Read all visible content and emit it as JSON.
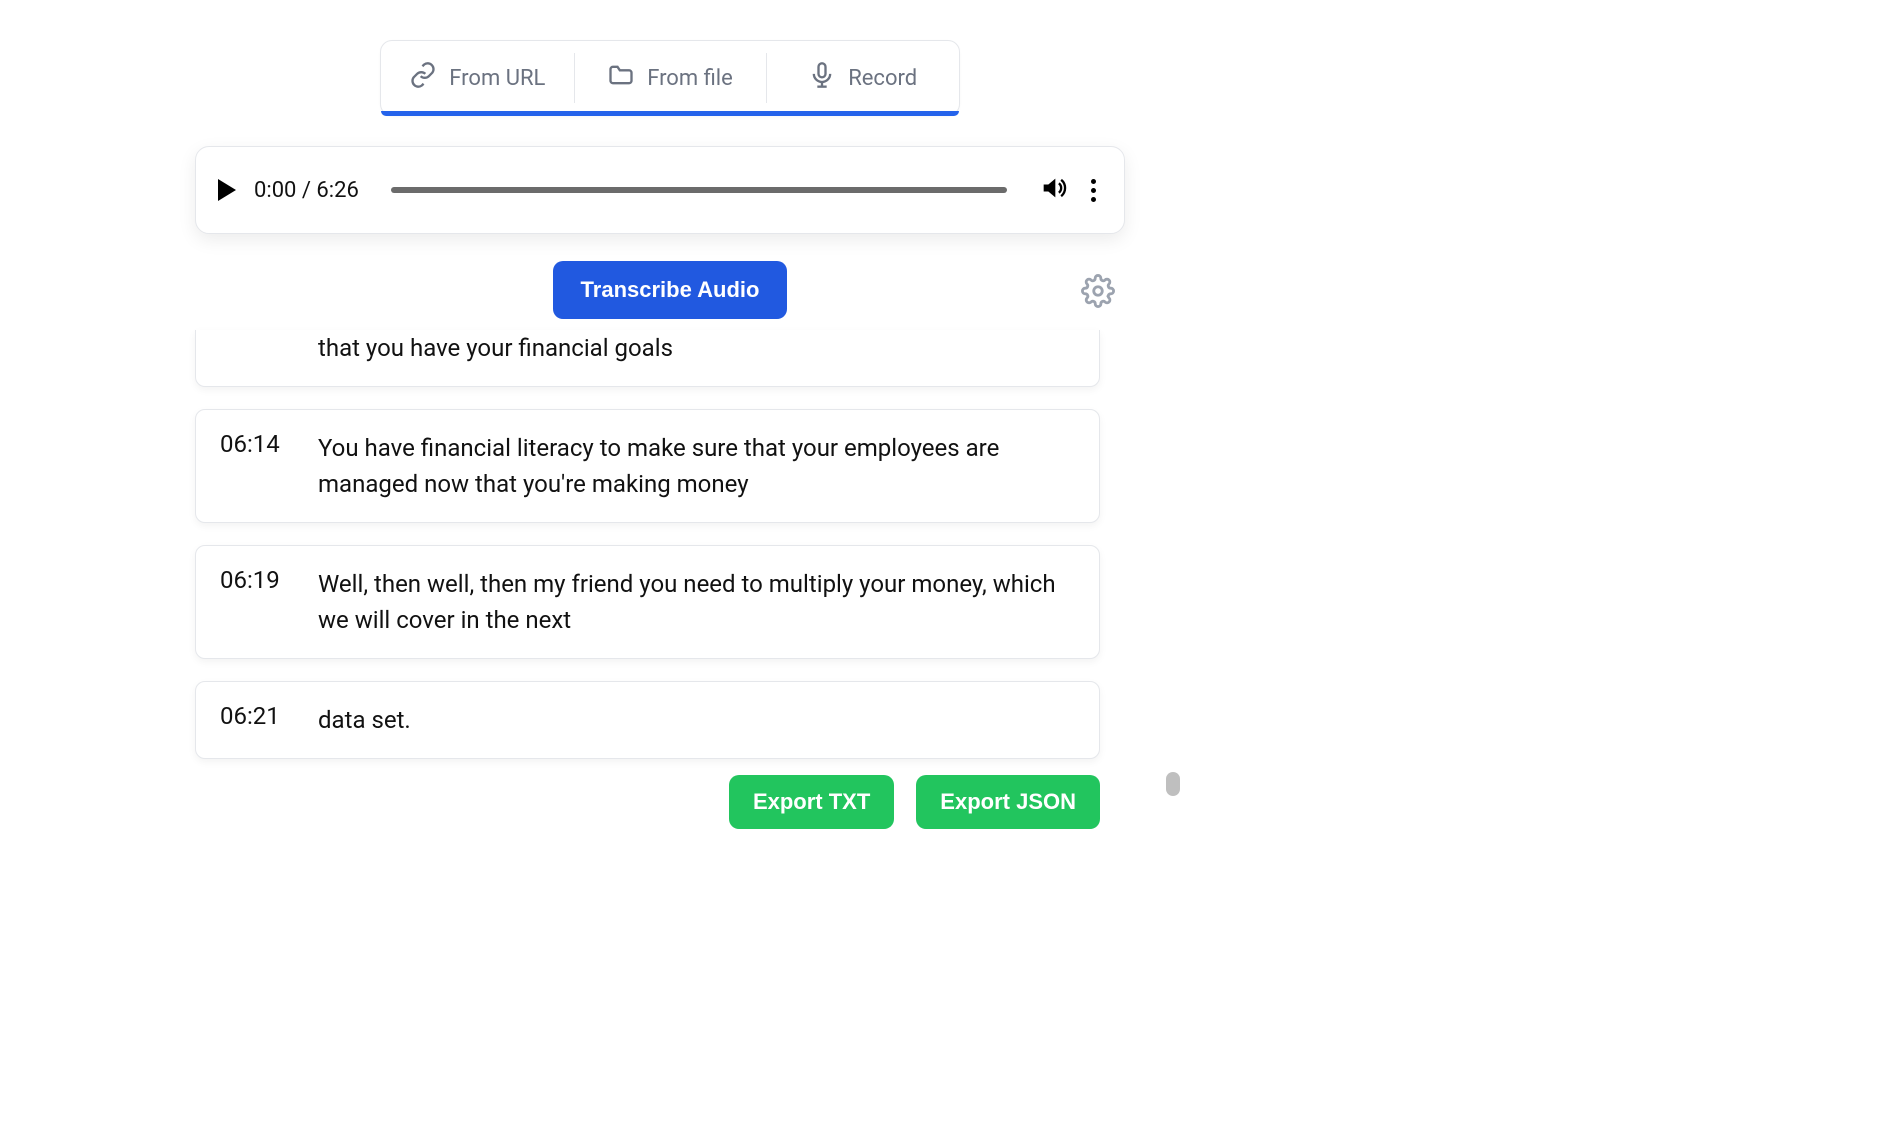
{
  "tabs": {
    "url_label": "From URL",
    "file_label": "From file",
    "record_label": "Record"
  },
  "player": {
    "time_text": "0:00 / 6:26"
  },
  "actions": {
    "transcribe_label": "Transcribe Audio"
  },
  "transcript": [
    {
      "time": "",
      "text": "that you have your financial goals"
    },
    {
      "time": "06:14",
      "text": "You have financial literacy to make sure that your employees are managed now that you're making money"
    },
    {
      "time": "06:19",
      "text": "Well, then well, then my friend you need to multiply your money, which we will cover in the next"
    },
    {
      "time": "06:21",
      "text": "data set."
    }
  ],
  "export": {
    "txt_label": "Export TXT",
    "json_label": "Export JSON"
  }
}
